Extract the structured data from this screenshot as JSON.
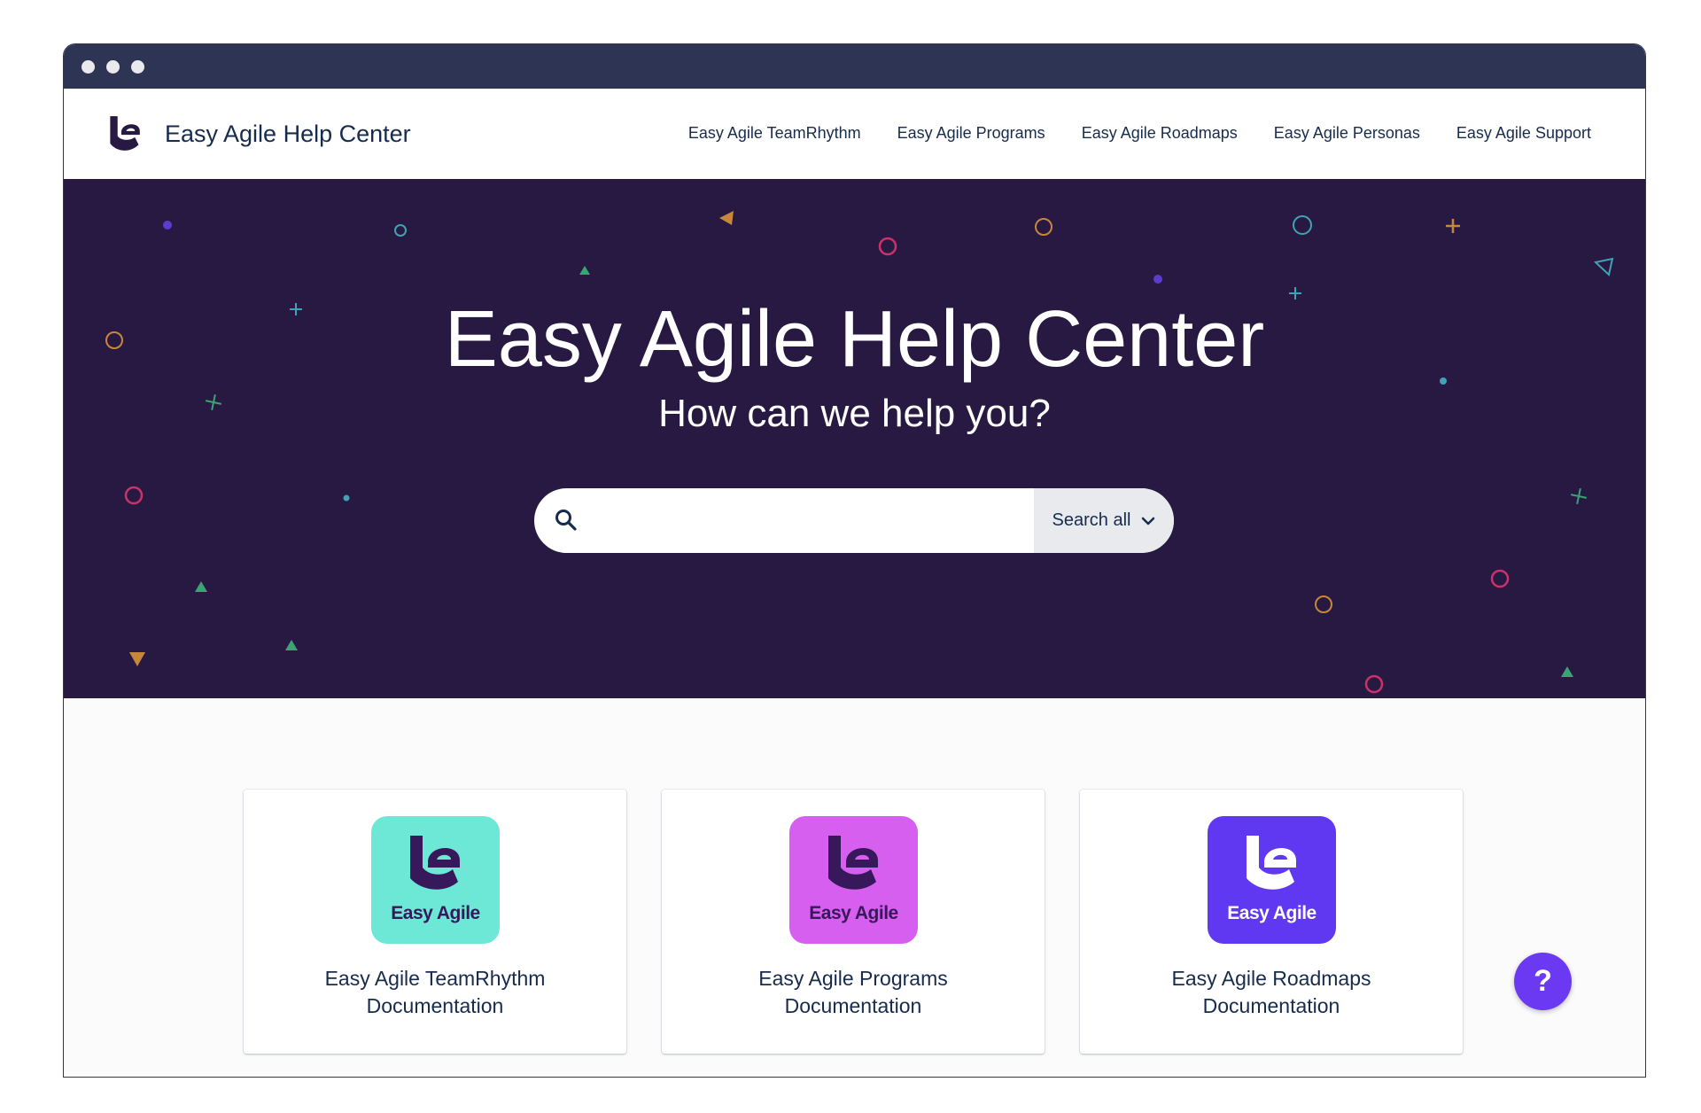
{
  "header": {
    "brand": "Easy Agile Help Center",
    "nav": [
      "Easy Agile TeamRhythm",
      "Easy Agile Programs",
      "Easy Agile Roadmaps",
      "Easy Agile Personas",
      "Easy Agile Support"
    ]
  },
  "hero": {
    "title": "Easy Agile Help Center",
    "subtitle": "How can we help you?",
    "search_placeholder": "",
    "search_scope": "Search all"
  },
  "cards": [
    {
      "logo_text": "Easy Agile",
      "title": "Easy Agile TeamRhythm Documentation",
      "tile_color": "#6de8d6",
      "mark_color": "#36185b"
    },
    {
      "logo_text": "Easy Agile",
      "title": "Easy Agile Programs Documentation",
      "tile_color": "#d65ff0",
      "mark_color": "#36185b"
    },
    {
      "logo_text": "Easy Agile",
      "title": "Easy Agile Roadmaps Documentation",
      "tile_color": "#6038f2",
      "mark_color": "#ffffff"
    }
  ],
  "help_button": "?",
  "colors": {
    "hero_bg": "#281942",
    "titlebar": "#2e3453",
    "help_button": "#6b39f2",
    "brand_dark": "#281942"
  }
}
